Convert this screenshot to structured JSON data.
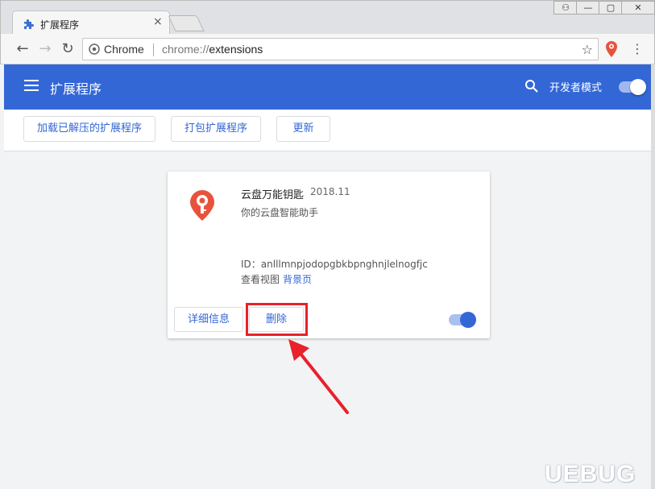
{
  "window": {
    "tab_title": "扩展程序",
    "tab_close": "×",
    "controls": [
      "⚇",
      "—",
      "▢",
      "✕"
    ]
  },
  "toolbar": {
    "back": "←",
    "forward": "→",
    "reload": "↻",
    "omnibox_chip": "Chrome",
    "url_scheme": "chrome://",
    "url_host": "extensions",
    "bookmark_star": "☆",
    "menu": "⋮"
  },
  "header": {
    "title": "扩展程序",
    "developer_mode_label": "开发者模式",
    "developer_mode_on": true
  },
  "subbar": {
    "load_unpacked": "加载已解压的扩展程序",
    "pack": "打包扩展程序",
    "update": "更新"
  },
  "extension": {
    "name": "云盘万能钥匙",
    "version": "2018.11",
    "description": "你的云盘智能助手",
    "id_text": "ID：anlllmnpjodopgbkbpnghnjlelnogfjc",
    "inspect_views_label": "查看视图",
    "inspect_views_link": "背景页",
    "details_button": "详细信息",
    "remove_button": "删除",
    "enabled": true
  },
  "watermark": "UEBUG",
  "colors": {
    "accent": "#3367d6",
    "highlight": "#e8212b",
    "logo": "#e8523c"
  }
}
